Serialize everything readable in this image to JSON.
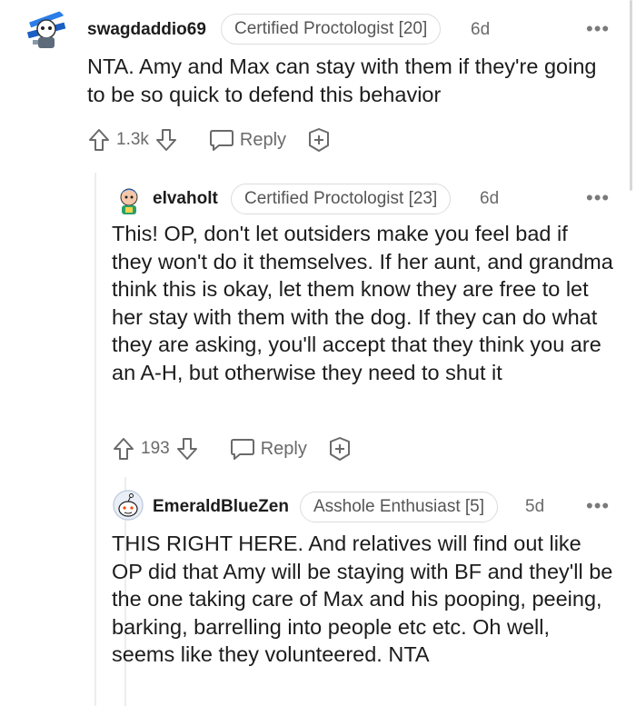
{
  "comments": [
    {
      "username": "swagdaddio69",
      "flair": "Certified Proctologist [20]",
      "age": "6d",
      "more": "•••",
      "body": "NTA. Amy and Max can stay with them if they're going to be so quick to defend this behavior",
      "votes": "1.3k",
      "reply_label": "Reply"
    },
    {
      "username": "elvaholt",
      "flair": "Certified Proctologist [23]",
      "age": "6d",
      "more": "•••",
      "body": "This! OP, don't let outsiders make you feel bad if they won't do it themselves. If her aunt, and grandma think this is okay, let them know they are free to let her stay with them with the dog. If they can do what they are asking, you'll accept that they think you are an A-H, but otherwise they need to shut it",
      "votes": "193",
      "reply_label": "Reply"
    },
    {
      "username": "EmeraldBlueZen",
      "flair": "Asshole Enthusiast [5]",
      "age": "5d",
      "more": "•••",
      "body": "THIS RIGHT HERE. And relatives will find out like OP did that Amy will be staying with BF and they'll be the one taking care of Max and his pooping, peeing, barking, barrelling into people etc etc. Oh well, seems like they volunteered. NTA"
    }
  ],
  "icons": {
    "upvote": "upvote-arrow-icon",
    "downvote": "downvote-arrow-icon",
    "reply": "speech-bubble-icon",
    "award": "plus-circle-icon"
  },
  "colors": {
    "text": "#1c1c1c",
    "meta": "#6a6a6a",
    "flair_border": "#dcdcdc"
  }
}
